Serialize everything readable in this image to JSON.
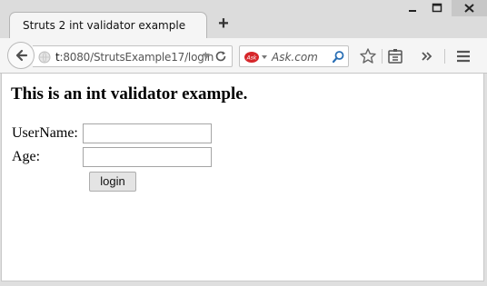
{
  "browser": {
    "tab_title": "Struts 2 int validator example",
    "new_tab_label": "+",
    "url_host_partial": "t",
    "url_rest": ":8080/StrutsExample17/login",
    "search_placeholder": "Ask.com",
    "icons": [
      "back-arrow-icon",
      "site-globe-icon",
      "dropdown-arrow-icon",
      "reload-icon",
      "ask-logo-icon",
      "search-icon",
      "bookmark-star-icon",
      "reading-list-icon",
      "overflow-chevron-icon",
      "menu-hamburger-icon",
      "minimize-icon",
      "maximize-icon",
      "close-icon"
    ]
  },
  "page": {
    "heading": "This is an int validator example.",
    "form": {
      "username_label": "UserName:",
      "username_value": "",
      "age_label": "Age:",
      "age_value": "",
      "submit_label": "login"
    }
  },
  "colors": {
    "ask_logo": "#d6262a",
    "search_icon": "#2a6fb5"
  }
}
